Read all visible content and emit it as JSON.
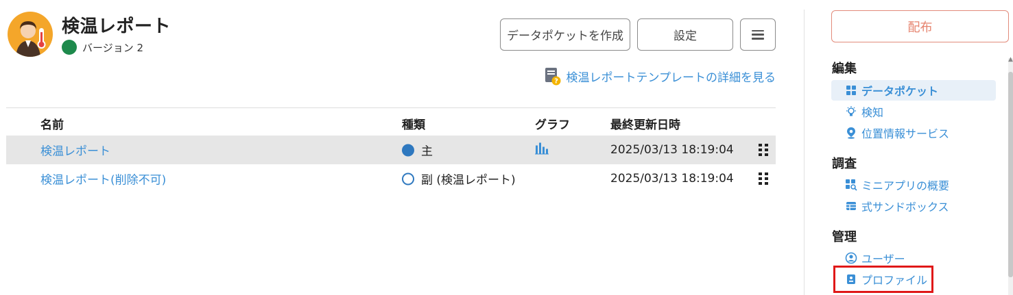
{
  "header": {
    "app_title": "検温レポート",
    "version_label": "バージョン 2",
    "version_status_color": "#1e8a4c",
    "app_icon": "thermometer-person-icon"
  },
  "toolbar": {
    "create_pocket_label": "データポケットを作成",
    "settings_label": "設定",
    "menu_icon": "hamburger-icon"
  },
  "template_link": {
    "text": "検温レポートテンプレートの詳細を見る",
    "icon": "document-help-icon"
  },
  "table": {
    "headers": {
      "name": "名前",
      "kind": "種類",
      "graph": "グラフ",
      "updated": "最終更新日時"
    },
    "rows": [
      {
        "name": "検温レポート",
        "kind": "主",
        "kind_style": "filled",
        "has_graph": true,
        "updated": "2025/03/13 18:19:04",
        "selected": true
      },
      {
        "name": "検温レポート(削除不可)",
        "kind": "副 (検温レポート)",
        "kind_style": "outline",
        "has_graph": false,
        "updated": "2025/03/13 18:19:04",
        "selected": false
      }
    ]
  },
  "sidebar": {
    "publish_label": "配布",
    "sections": [
      {
        "title": "編集",
        "items": [
          {
            "label": "データポケット",
            "icon": "grid-icon",
            "active": true
          },
          {
            "label": "検知",
            "icon": "lightbulb-icon",
            "active": false
          },
          {
            "label": "位置情報サービス",
            "icon": "location-pin-icon",
            "active": false
          }
        ]
      },
      {
        "title": "調査",
        "items": [
          {
            "label": "ミニアプリの概要",
            "icon": "grid-search-icon",
            "active": false
          },
          {
            "label": "式サンドボックス",
            "icon": "table-icon",
            "active": false
          }
        ]
      },
      {
        "title": "管理",
        "items": [
          {
            "label": "ユーザー",
            "icon": "user-circle-icon",
            "active": false
          },
          {
            "label": "プロファイル",
            "icon": "profile-card-icon",
            "active": false,
            "highlighted": true
          }
        ]
      }
    ]
  },
  "colors": {
    "link": "#3a8fd6",
    "publish": "#e6846f",
    "highlight": "#e01818",
    "selected_row": "#e6e6e6"
  }
}
